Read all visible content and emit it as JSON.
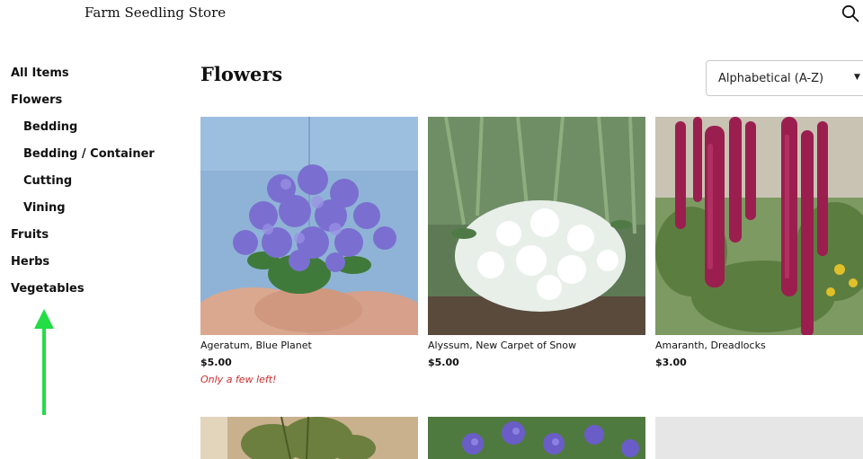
{
  "header": {
    "store_name": "Farm Seedling Store",
    "search_icon": "search-icon"
  },
  "sidebar": {
    "items": [
      {
        "label": "All Items",
        "level": 0
      },
      {
        "label": "Flowers",
        "level": 0
      },
      {
        "label": "Bedding",
        "level": 1
      },
      {
        "label": "Bedding / Container",
        "level": 1
      },
      {
        "label": "Cutting",
        "level": 1
      },
      {
        "label": "Vining",
        "level": 1
      },
      {
        "label": "Fruits",
        "level": 0
      },
      {
        "label": "Herbs",
        "level": 0
      },
      {
        "label": "Vegetables",
        "level": 0
      }
    ]
  },
  "annotation": {
    "arrow_icon": "up-arrow-icon",
    "color": "#22dd44"
  },
  "main": {
    "title": "Flowers",
    "sort": {
      "selected": "Alphabetical (A-Z)",
      "caret_icon": "caret-down-icon"
    },
    "products": [
      {
        "name": "Ageratum, Blue Planet",
        "price": "$5.00",
        "note": "Only a few left!"
      },
      {
        "name": "Alyssum, New Carpet of Snow",
        "price": "$5.00"
      },
      {
        "name": "Amaranth, Dreadlocks",
        "price": "$3.00"
      }
    ]
  },
  "colors": {
    "stock_warning": "#cc2b2b",
    "text": "#111111",
    "placeholder": "#e6e6e6"
  }
}
